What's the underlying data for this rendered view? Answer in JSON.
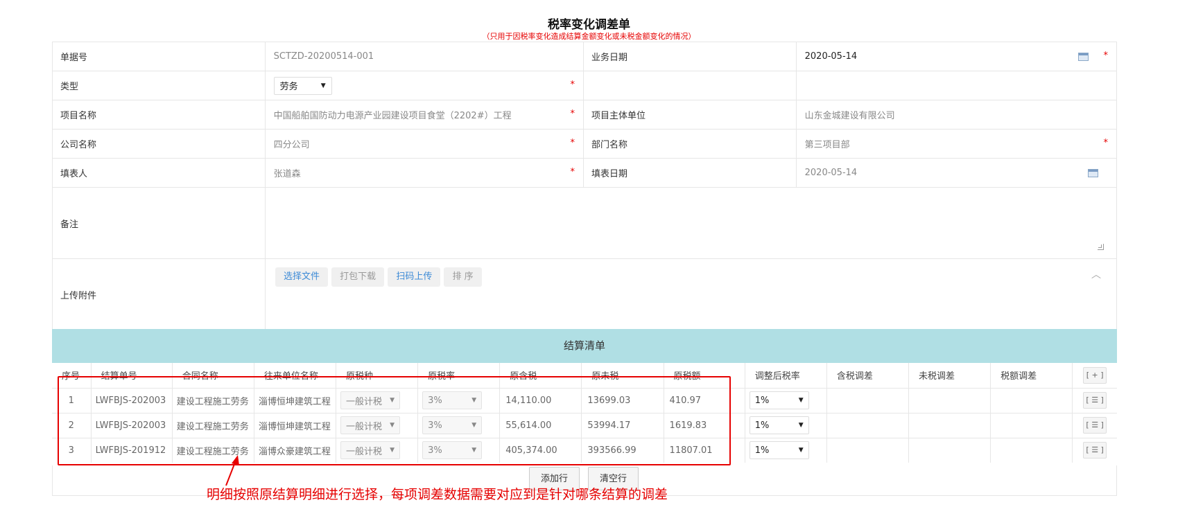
{
  "page": {
    "title": "税率变化调差单",
    "subtitle": "（只用于因税率变化造成结算金额变化或未税金额变化的情况）"
  },
  "form": {
    "doc_no_label": "单据号",
    "doc_no_value": "SCTZD-20200514-001",
    "biz_date_label": "业务日期",
    "biz_date_value": "2020-05-14",
    "type_label": "类型",
    "type_value": "劳务",
    "project_name_label": "项目名称",
    "project_name_value": "中国船舶国防动力电源产业园建设项目食堂（2202#）工程",
    "project_owner_label": "项目主体单位",
    "project_owner_value": "山东金城建设有限公司",
    "company_label": "公司名称",
    "company_value": "四分公司",
    "dept_label": "部门名称",
    "dept_value": "第三项目部",
    "filler_label": "填表人",
    "filler_value": "张道森",
    "fill_date_label": "填表日期",
    "fill_date_value": "2020-05-14",
    "remark_label": "备注",
    "upload_label": "上传附件",
    "required_mark": "*"
  },
  "upload": {
    "choose_file": "选择文件",
    "pack_download": "打包下载",
    "scan_upload": "扫码上传",
    "sort": "排 序"
  },
  "settlement": {
    "title": "结算清单",
    "columns": [
      "序号",
      "结算单号",
      "合同名称",
      "往来单位名称",
      "原税种",
      "原税率",
      "原含税",
      "原未税",
      "原税额",
      "调整后税率",
      "含税调差",
      "未税调差",
      "税额调差"
    ],
    "add_row_icon": "[ + ]",
    "row_menu_icon": "[ ☰ ]",
    "rows": [
      {
        "no": "1",
        "settle_no": "LWFBJS-202003",
        "contract": "建设工程施工劳务",
        "partner": "淄博恒坤建筑工程",
        "tax_type": "一般计税",
        "tax_rate": "3%",
        "incl_tax": "14,110.00",
        "excl_tax": "13699.03",
        "tax_amt": "410.97",
        "new_rate": "1%"
      },
      {
        "no": "2",
        "settle_no": "LWFBJS-202003",
        "contract": "建设工程施工劳务",
        "partner": "淄博恒坤建筑工程",
        "tax_type": "一般计税",
        "tax_rate": "3%",
        "incl_tax": "55,614.00",
        "excl_tax": "53994.17",
        "tax_amt": "1619.83",
        "new_rate": "1%"
      },
      {
        "no": "3",
        "settle_no": "LWFBJS-201912",
        "contract": "建设工程施工劳务",
        "partner": "淄博众豪建筑工程",
        "tax_type": "一般计税",
        "tax_rate": "3%",
        "incl_tax": "405,374.00",
        "excl_tax": "393566.99",
        "tax_amt": "11807.01",
        "new_rate": "1%"
      }
    ],
    "add_row_button": "添加行",
    "clear_row_button": "清空行"
  },
  "annotation": {
    "text": "明细按照原结算明细进行选择，每项调差数据需要对应到是针对哪条结算的调差"
  },
  "colors": {
    "header_bg": "#b0dfe4",
    "required": "#e60000",
    "link_blue": "#3c8ad6",
    "annotation_red": "#e60000"
  }
}
